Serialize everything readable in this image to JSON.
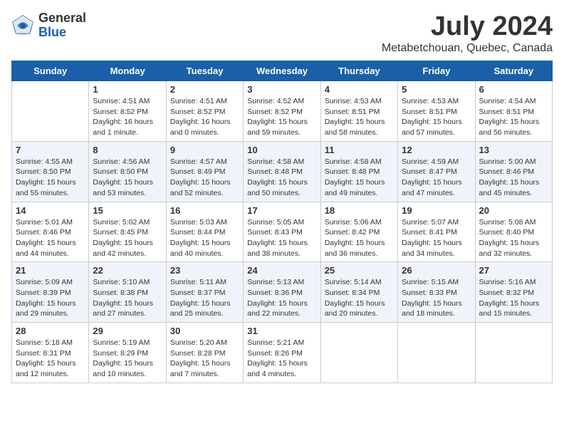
{
  "logo": {
    "general": "General",
    "blue": "Blue"
  },
  "header": {
    "title": "July 2024",
    "subtitle": "Metabetchouan, Quebec, Canada"
  },
  "days_of_week": [
    "Sunday",
    "Monday",
    "Tuesday",
    "Wednesday",
    "Thursday",
    "Friday",
    "Saturday"
  ],
  "weeks": [
    [
      {
        "day": "",
        "info": ""
      },
      {
        "day": "1",
        "info": "Sunrise: 4:51 AM\nSunset: 8:52 PM\nDaylight: 16 hours\nand 1 minute."
      },
      {
        "day": "2",
        "info": "Sunrise: 4:51 AM\nSunset: 8:52 PM\nDaylight: 16 hours\nand 0 minutes."
      },
      {
        "day": "3",
        "info": "Sunrise: 4:52 AM\nSunset: 8:52 PM\nDaylight: 15 hours\nand 59 minutes."
      },
      {
        "day": "4",
        "info": "Sunrise: 4:53 AM\nSunset: 8:51 PM\nDaylight: 15 hours\nand 58 minutes."
      },
      {
        "day": "5",
        "info": "Sunrise: 4:53 AM\nSunset: 8:51 PM\nDaylight: 15 hours\nand 57 minutes."
      },
      {
        "day": "6",
        "info": "Sunrise: 4:54 AM\nSunset: 8:51 PM\nDaylight: 15 hours\nand 56 minutes."
      }
    ],
    [
      {
        "day": "7",
        "info": "Sunrise: 4:55 AM\nSunset: 8:50 PM\nDaylight: 15 hours\nand 55 minutes."
      },
      {
        "day": "8",
        "info": "Sunrise: 4:56 AM\nSunset: 8:50 PM\nDaylight: 15 hours\nand 53 minutes."
      },
      {
        "day": "9",
        "info": "Sunrise: 4:57 AM\nSunset: 8:49 PM\nDaylight: 15 hours\nand 52 minutes."
      },
      {
        "day": "10",
        "info": "Sunrise: 4:58 AM\nSunset: 8:48 PM\nDaylight: 15 hours\nand 50 minutes."
      },
      {
        "day": "11",
        "info": "Sunrise: 4:58 AM\nSunset: 8:48 PM\nDaylight: 15 hours\nand 49 minutes."
      },
      {
        "day": "12",
        "info": "Sunrise: 4:59 AM\nSunset: 8:47 PM\nDaylight: 15 hours\nand 47 minutes."
      },
      {
        "day": "13",
        "info": "Sunrise: 5:00 AM\nSunset: 8:46 PM\nDaylight: 15 hours\nand 45 minutes."
      }
    ],
    [
      {
        "day": "14",
        "info": "Sunrise: 5:01 AM\nSunset: 8:46 PM\nDaylight: 15 hours\nand 44 minutes."
      },
      {
        "day": "15",
        "info": "Sunrise: 5:02 AM\nSunset: 8:45 PM\nDaylight: 15 hours\nand 42 minutes."
      },
      {
        "day": "16",
        "info": "Sunrise: 5:03 AM\nSunset: 8:44 PM\nDaylight: 15 hours\nand 40 minutes."
      },
      {
        "day": "17",
        "info": "Sunrise: 5:05 AM\nSunset: 8:43 PM\nDaylight: 15 hours\nand 38 minutes."
      },
      {
        "day": "18",
        "info": "Sunrise: 5:06 AM\nSunset: 8:42 PM\nDaylight: 15 hours\nand 36 minutes."
      },
      {
        "day": "19",
        "info": "Sunrise: 5:07 AM\nSunset: 8:41 PM\nDaylight: 15 hours\nand 34 minutes."
      },
      {
        "day": "20",
        "info": "Sunrise: 5:08 AM\nSunset: 8:40 PM\nDaylight: 15 hours\nand 32 minutes."
      }
    ],
    [
      {
        "day": "21",
        "info": "Sunrise: 5:09 AM\nSunset: 8:39 PM\nDaylight: 15 hours\nand 29 minutes."
      },
      {
        "day": "22",
        "info": "Sunrise: 5:10 AM\nSunset: 8:38 PM\nDaylight: 15 hours\nand 27 minutes."
      },
      {
        "day": "23",
        "info": "Sunrise: 5:11 AM\nSunset: 8:37 PM\nDaylight: 15 hours\nand 25 minutes."
      },
      {
        "day": "24",
        "info": "Sunrise: 5:13 AM\nSunset: 8:36 PM\nDaylight: 15 hours\nand 22 minutes."
      },
      {
        "day": "25",
        "info": "Sunrise: 5:14 AM\nSunset: 8:34 PM\nDaylight: 15 hours\nand 20 minutes."
      },
      {
        "day": "26",
        "info": "Sunrise: 5:15 AM\nSunset: 8:33 PM\nDaylight: 15 hours\nand 18 minutes."
      },
      {
        "day": "27",
        "info": "Sunrise: 5:16 AM\nSunset: 8:32 PM\nDaylight: 15 hours\nand 15 minutes."
      }
    ],
    [
      {
        "day": "28",
        "info": "Sunrise: 5:18 AM\nSunset: 8:31 PM\nDaylight: 15 hours\nand 12 minutes."
      },
      {
        "day": "29",
        "info": "Sunrise: 5:19 AM\nSunset: 8:29 PM\nDaylight: 15 hours\nand 10 minutes."
      },
      {
        "day": "30",
        "info": "Sunrise: 5:20 AM\nSunset: 8:28 PM\nDaylight: 15 hours\nand 7 minutes."
      },
      {
        "day": "31",
        "info": "Sunrise: 5:21 AM\nSunset: 8:26 PM\nDaylight: 15 hours\nand 4 minutes."
      },
      {
        "day": "",
        "info": ""
      },
      {
        "day": "",
        "info": ""
      },
      {
        "day": "",
        "info": ""
      }
    ]
  ]
}
